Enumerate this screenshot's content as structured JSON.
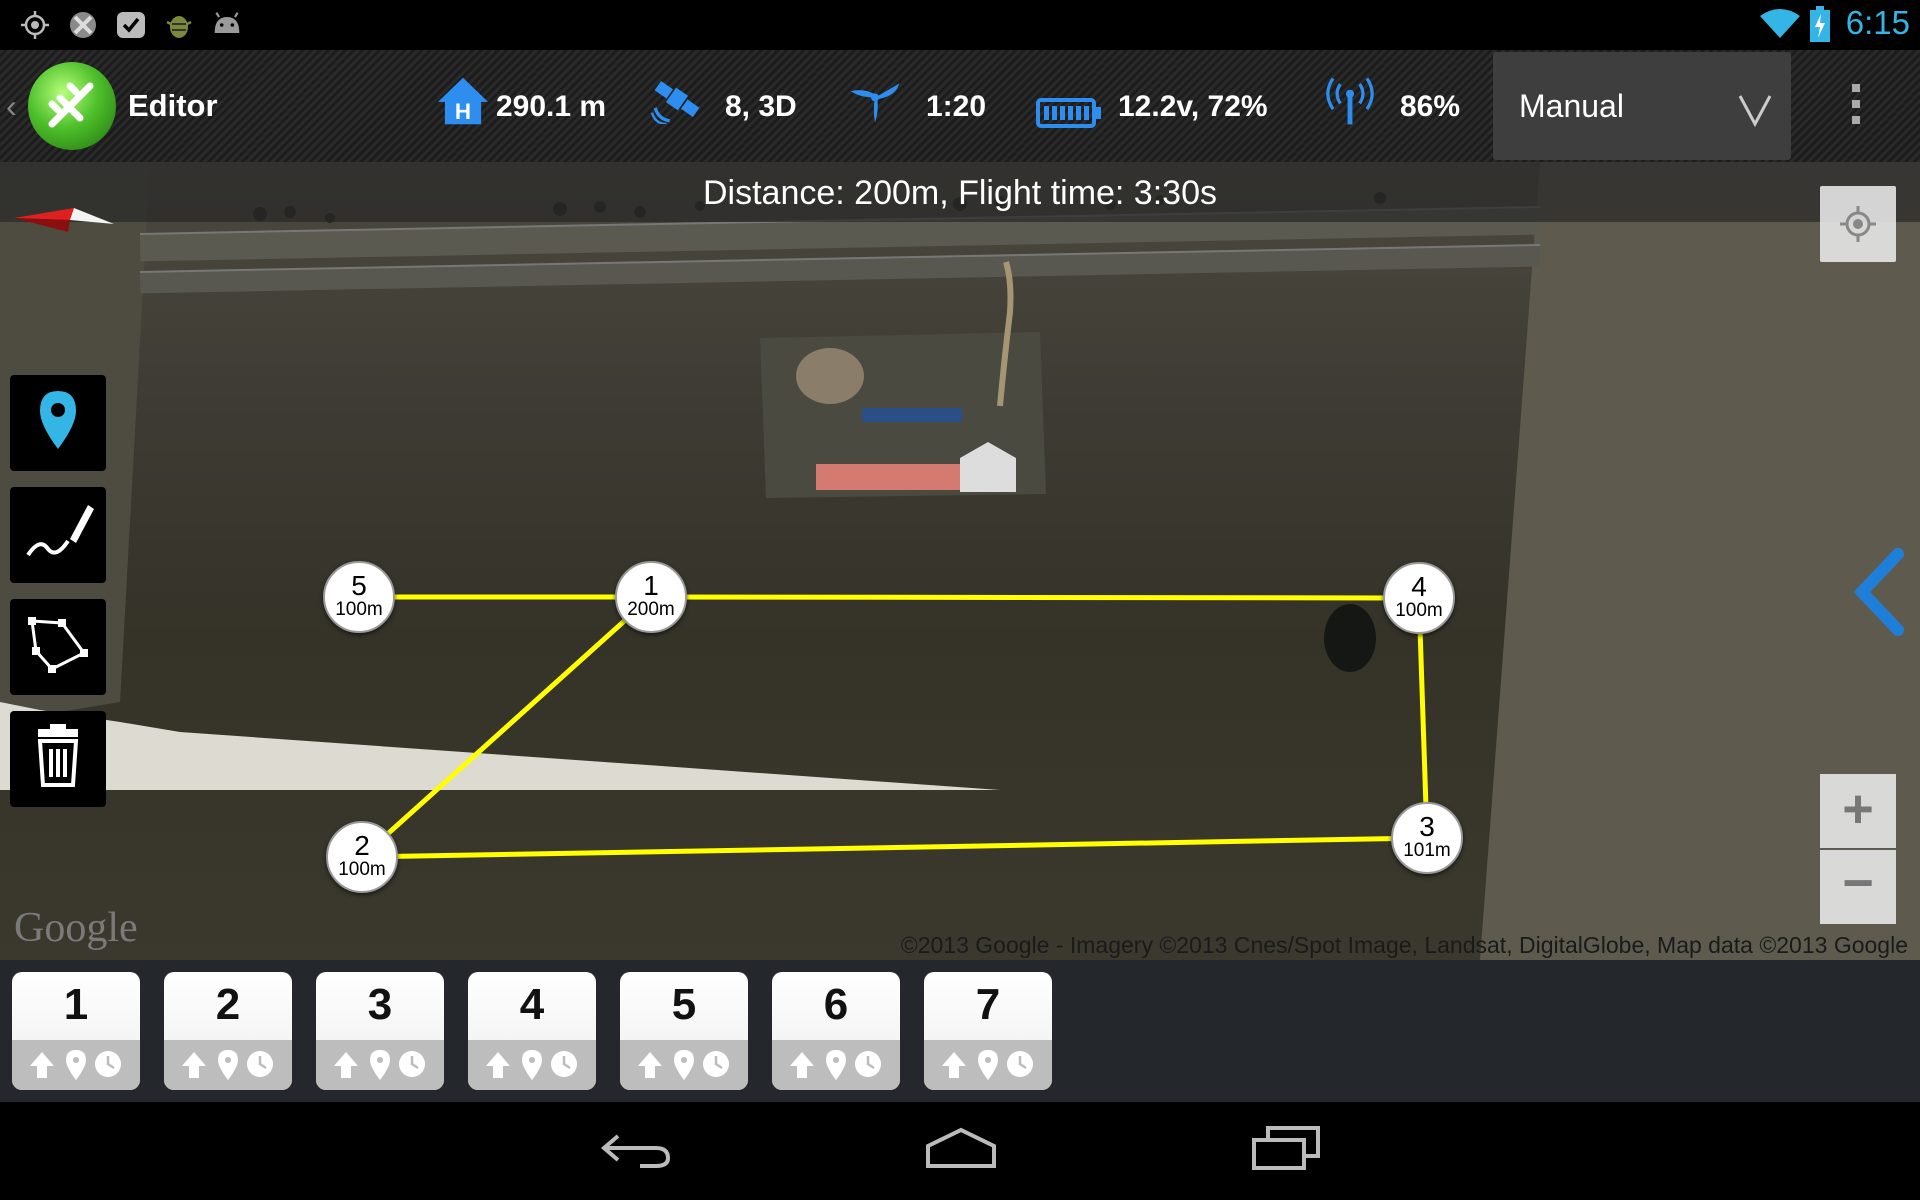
{
  "status_bar": {
    "time": "6:15",
    "notification_icons": [
      "gps-icon",
      "app-notification-icon",
      "check-icon",
      "debug-bug-icon",
      "android-icon"
    ],
    "system_icons": [
      "wifi-icon",
      "battery-charging-icon"
    ]
  },
  "action_bar": {
    "title": "Editor",
    "telemetry": {
      "home_distance": "290.1 m",
      "gps": "8, 3D",
      "rotor": "1:20",
      "battery": "12.2v, 72%",
      "signal": "86%"
    },
    "mode": {
      "selected": "Manual"
    }
  },
  "map": {
    "info": "Distance: 200m, Flight time: 3:30s",
    "waypoints": [
      {
        "num": "1",
        "alt": "200m"
      },
      {
        "num": "2",
        "alt": "100m"
      },
      {
        "num": "3",
        "alt": "101m"
      },
      {
        "num": "4",
        "alt": "100m"
      },
      {
        "num": "5",
        "alt": "100m"
      }
    ],
    "path_color": "#ffff00",
    "google_label": "Google",
    "attribution": "©2013 Google - Imagery ©2013 Cnes/Spot Image, Landsat, DigitalGlobe, Map data ©2013 Google",
    "zoom_in": "+",
    "zoom_out": "−"
  },
  "tools": [
    "marker-tool",
    "draw-path-tool",
    "polygon-tool",
    "trash-tool"
  ],
  "mission_items": [
    "1",
    "2",
    "3",
    "4",
    "5",
    "6",
    "7"
  ],
  "colors": {
    "accent": "#33b5e5",
    "telemetry_icon": "#2e8ef0",
    "mission_strip": "#24272c"
  }
}
